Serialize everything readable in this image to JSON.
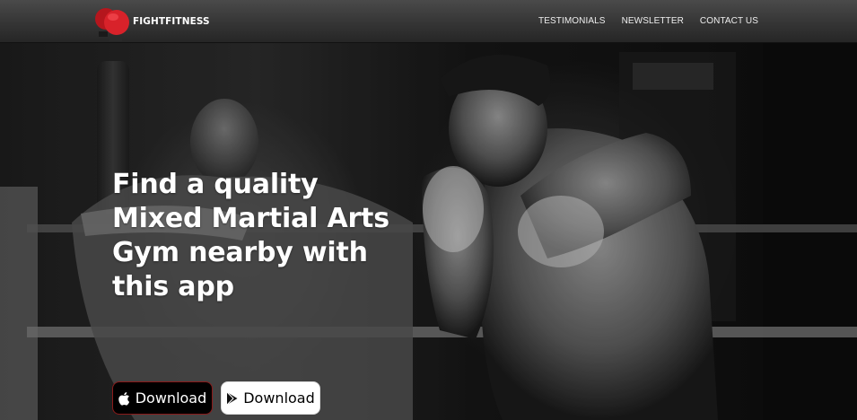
{
  "header": {
    "brand": "FIGHTFITNESS",
    "nav": [
      "TESTIMONIALS",
      "NEWSLETTER",
      "CONTACT US"
    ]
  },
  "hero": {
    "headline": "Find a quality Mixed Martial Arts Gym nearby with this app",
    "buttons": {
      "apple_label": "Download",
      "play_label": "Download"
    }
  },
  "colors": {
    "accent_red": "#d11f26",
    "header_bg": "#3a3a3a"
  },
  "icons": {
    "logo": "boxing-gloves-icon",
    "apple": "apple-icon",
    "play": "google-play-icon"
  }
}
